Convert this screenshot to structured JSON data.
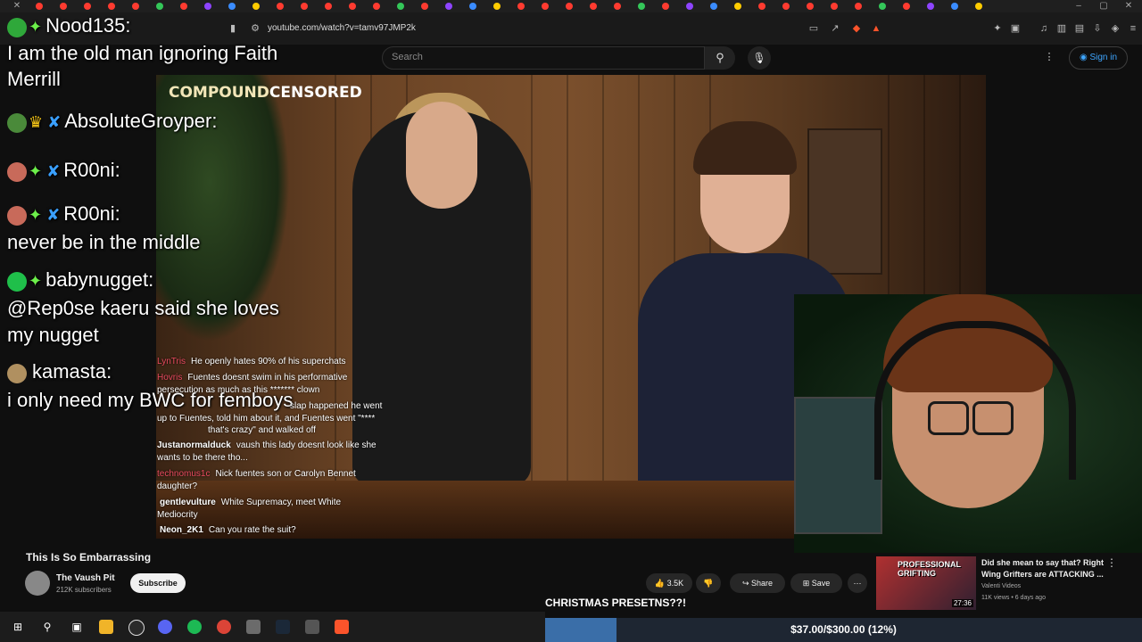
{
  "browser": {
    "url": "youtube.com/watch?v=tamv97JMP2k"
  },
  "youtube": {
    "search_placeholder": "Search",
    "sign_in": "Sign in"
  },
  "video_overlay": {
    "compound_a": "COMPOUND",
    "compound_b": "CENSORED"
  },
  "chat": [
    {
      "name": "Nood135:",
      "message": "I am the old man ignoring Faith"
    },
    {
      "message_cont": "Merrill"
    },
    {
      "name": "AbsoluteGroyper:"
    },
    {
      "name": "R00ni:"
    },
    {
      "name": "R00ni:",
      "message": "never be in the middle"
    },
    {
      "name": "babynugget:",
      "message": "@Rep0se kaeru said she loves",
      "message_cont": "my nugget"
    },
    {
      "name": "kamasta:",
      "message": "i only need my BWC for femboys"
    }
  ],
  "superchats": [
    {
      "user": "LynTris",
      "text": "He openly hates 90% of his superchats"
    },
    {
      "user": "Hovris",
      "text": "Fuentes doesnt swim in his performative"
    },
    {
      "user": "",
      "text": "persecution as much as this ******* clown"
    },
    {
      "user": "",
      "text": "slap happened he went"
    },
    {
      "user": "",
      "text": "up to Fuentes, told him about it, and Fuentes went \"****"
    },
    {
      "user": "",
      "text": "that's crazy\" and walked off"
    },
    {
      "user": "Justanormalduck",
      "text": "vaush this lady doesnt look like she"
    },
    {
      "user": "",
      "text": "wants to be there tho..."
    },
    {
      "user": "technomus1c",
      "text": "Nick fuentes son or Carolyn Bennet"
    },
    {
      "user": "",
      "text": "daughter?"
    },
    {
      "user": "gentlevulture",
      "text": "White Supremacy, meet White"
    },
    {
      "user": "",
      "text": "Mediocrity"
    },
    {
      "user": "Neon_2K1",
      "text": "Can you rate the suit?"
    }
  ],
  "video_info": {
    "title": "This Is So Embarrassing",
    "channel": "The Vaush Pit",
    "subscribers": "212K subscribers",
    "subscribe": "Subscribe",
    "likes": "3.5K",
    "share": "Share",
    "save": "Save"
  },
  "recommended": {
    "thumb_text_1": "PROFESSIONAL",
    "thumb_text_2": "GRIFTING",
    "duration": "27:36",
    "title": "Did she mean to say that? Right Wing Grifters are ATTACKING ...",
    "channel": "Valenti Videos",
    "meta": "11K views • 6 days ago"
  },
  "donation": {
    "title": "CHRISTMAS PRESETNS??!",
    "progress_text": "$37.00/$300.00 (12%)",
    "progress": 0.12
  }
}
